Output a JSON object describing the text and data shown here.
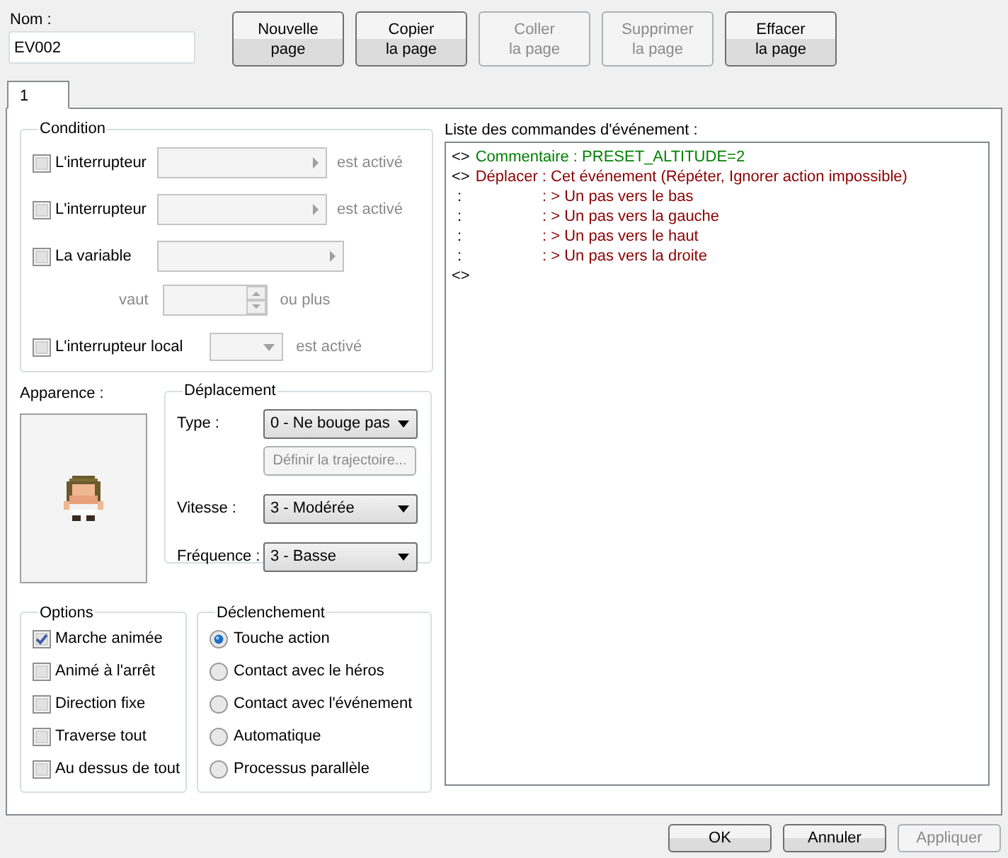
{
  "name_field": {
    "label": "Nom :",
    "value": "EV002"
  },
  "page_buttons": [
    {
      "lines": [
        "Nouvelle",
        "page"
      ],
      "disabled": false
    },
    {
      "lines": [
        "Copier",
        "la page"
      ],
      "disabled": false
    },
    {
      "lines": [
        "Coller",
        "la page"
      ],
      "disabled": true
    },
    {
      "lines": [
        "Supprimer",
        "la page"
      ],
      "disabled": true
    },
    {
      "lines": [
        "Effacer",
        "la page"
      ],
      "disabled": false
    }
  ],
  "tabs": [
    {
      "label": "1",
      "selected": true
    }
  ],
  "condition": {
    "title": "Condition",
    "items": [
      {
        "kind": "switch",
        "label": "L'interrupteur",
        "checked": false,
        "suffix": "est activé"
      },
      {
        "kind": "switch",
        "label": "L'interrupteur",
        "checked": false,
        "suffix": "est activé"
      },
      {
        "kind": "variable",
        "label": "La variable",
        "checked": false,
        "value_label": "vaut",
        "value_suffix": "ou plus"
      },
      {
        "kind": "local_switch",
        "label": "L'interrupteur local",
        "checked": false,
        "suffix": "est activé"
      }
    ]
  },
  "appearance": {
    "label": "Apparence :"
  },
  "movement": {
    "title": "Déplacement",
    "fields": [
      {
        "kind": "select",
        "label": "Type :",
        "value": "0 - Ne bouge pas"
      },
      {
        "kind": "button",
        "label": "Définir la trajectoire...",
        "disabled": true
      },
      {
        "kind": "select",
        "label": "Vitesse :",
        "value": "3 - Modérée"
      },
      {
        "kind": "select",
        "label": "Fréquence :",
        "value": "3 - Basse"
      }
    ]
  },
  "options": {
    "title": "Options",
    "items": [
      {
        "label": "Marche animée",
        "checked": true
      },
      {
        "label": "Animé à l'arrêt",
        "checked": false
      },
      {
        "label": "Direction fixe",
        "checked": false
      },
      {
        "label": "Traverse tout",
        "checked": false
      },
      {
        "label": "Au dessus de tout",
        "checked": false
      }
    ]
  },
  "trigger": {
    "title": "Déclenchement",
    "items": [
      {
        "label": "Touche action",
        "selected": true
      },
      {
        "label": "Contact avec le héros",
        "selected": false
      },
      {
        "label": "Contact avec l'événement",
        "selected": false
      },
      {
        "label": "Automatique",
        "selected": false
      },
      {
        "label": "Processus parallèle",
        "selected": false
      }
    ]
  },
  "command_list": {
    "label": "Liste des commandes d'événement :",
    "commands": [
      {
        "kind": "comment",
        "prefix": "<>",
        "text": "Commentaire : PRESET_ALTITUDE=2"
      },
      {
        "kind": "move",
        "prefix": "<>",
        "text": "Déplacer : Cet événement (Répéter, Ignorer action impossible)"
      },
      {
        "kind": "step",
        "prefix": ":",
        "text": ": > Un pas vers le bas"
      },
      {
        "kind": "step",
        "prefix": ":",
        "text": ": > Un pas vers la gauche"
      },
      {
        "kind": "step",
        "prefix": ":",
        "text": ": > Un pas vers le haut"
      },
      {
        "kind": "step",
        "prefix": ":",
        "text": ": > Un pas vers la droite"
      },
      {
        "kind": "end",
        "prefix": "<>"
      }
    ]
  },
  "dialog_buttons": [
    {
      "label": "OK",
      "disabled": false
    },
    {
      "label": "Annuler",
      "disabled": false
    },
    {
      "label": "Appliquer",
      "disabled": true
    }
  ]
}
